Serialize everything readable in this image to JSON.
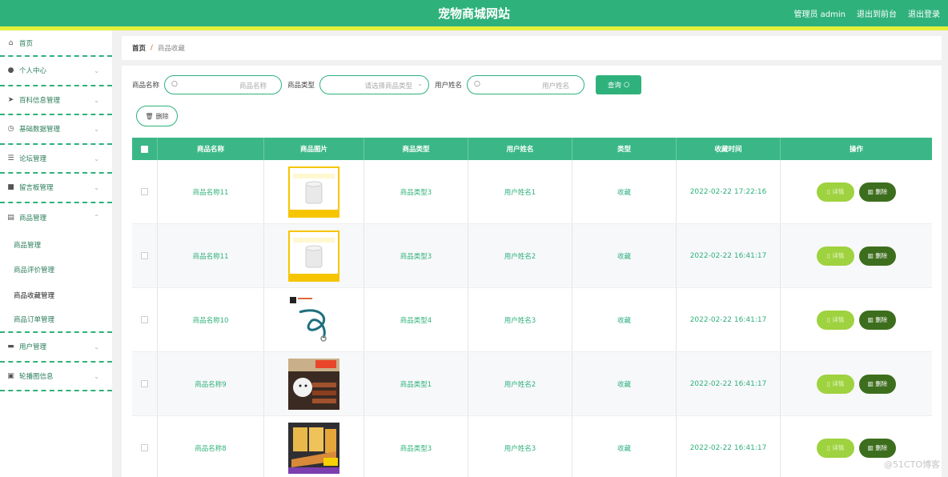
{
  "header": {
    "title": "宠物商城网站",
    "admin_label": "管理员 admin",
    "back_frontend": "退出到前台",
    "logout": "退出登录"
  },
  "sidebar": {
    "items": [
      {
        "label": "首页",
        "icon": "home-icon"
      },
      {
        "label": "个人中心",
        "icon": "user-icon"
      },
      {
        "label": "百科信息管理",
        "icon": "send-icon"
      },
      {
        "label": "基础数据管理",
        "icon": "clock-icon"
      },
      {
        "label": "论坛管理",
        "icon": "sliders-icon"
      },
      {
        "label": "留言板管理",
        "icon": "message-icon"
      },
      {
        "label": "商品管理",
        "icon": "goods-icon"
      },
      {
        "label": "用户管理",
        "icon": "chat-icon"
      },
      {
        "label": "轮播图信息",
        "icon": "clipboard-icon"
      }
    ],
    "sub_items": [
      "商品管理",
      "商品评价管理",
      "商品收藏管理",
      "商品订单管理"
    ]
  },
  "breadcrumb": {
    "home": "首页",
    "separator": "/",
    "current": "商品收藏"
  },
  "search": {
    "name_label": "商品名称",
    "name_placeholder": "商品名称",
    "type_label": "商品类型",
    "type_placeholder": "请选择商品类型",
    "user_label": "用户姓名",
    "user_placeholder": "用户姓名",
    "query_button": "查询"
  },
  "delete_button": "删除",
  "table": {
    "columns": [
      "商品名称",
      "商品图片",
      "商品类型",
      "用户姓名",
      "类型",
      "收藏时间",
      "操作"
    ],
    "rows": [
      {
        "name": "商品名称11",
        "type": "商品类型3",
        "user": "用户姓名1",
        "kind": "收藏",
        "time": "2022-02-22 17:22:16"
      },
      {
        "name": "商品名称11",
        "type": "商品类型3",
        "user": "用户姓名2",
        "kind": "收藏",
        "time": "2022-02-22 16:41:17"
      },
      {
        "name": "商品名称10",
        "type": "商品类型4",
        "user": "用户姓名3",
        "kind": "收藏",
        "time": "2022-02-22 16:41:17"
      },
      {
        "name": "商品名称9",
        "type": "商品类型1",
        "user": "用户姓名2",
        "kind": "收藏",
        "time": "2022-02-22 16:41:17"
      },
      {
        "name": "商品名称8",
        "type": "商品类型3",
        "user": "用户姓名3",
        "kind": "收藏",
        "time": "2022-02-22 16:41:17"
      }
    ],
    "detail_label": "详情",
    "delete_label": "删除"
  },
  "watermark": "@51CTO博客",
  "colors": {
    "primary": "#2fb17c",
    "accent_yellow": "#e3f03a",
    "detail_btn": "#9fd23f",
    "delete_btn": "#3d6e1e"
  }
}
